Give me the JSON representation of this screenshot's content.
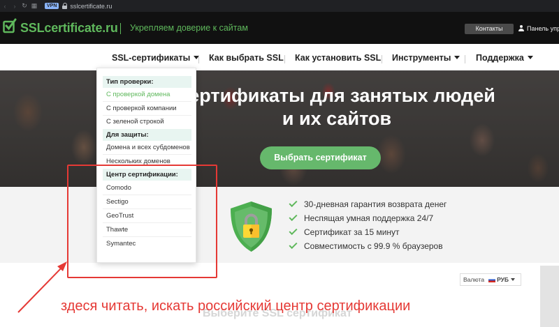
{
  "browser": {
    "vpn_badge": "VPN",
    "url": "sslcertificate.ru"
  },
  "header": {
    "logo": "SSLcertificate.ru",
    "tagline": "Укрепляем доверие к сайтам",
    "contacts_button": "Контакты",
    "panel_link": "Панель управления",
    "brand_color": "#5fb85c"
  },
  "nav": {
    "items": [
      {
        "label": "SSL-сертификаты",
        "has_caret": true
      },
      {
        "label": "Как выбрать SSL",
        "has_caret": false
      },
      {
        "label": "Как установить SSL",
        "has_caret": false
      },
      {
        "label": "Инструменты",
        "has_caret": true
      },
      {
        "label": "Поддержка",
        "has_caret": true
      }
    ]
  },
  "hero": {
    "title": "сертификаты для занятых людей и их сайтов",
    "button": "Выбрать сертификат",
    "button_color": "#66b86c"
  },
  "dropdown": {
    "sections": [
      {
        "heading": "Тип проверки:",
        "items": [
          "С проверкой домена",
          "С проверкой компании",
          "С зеленой строкой"
        ]
      },
      {
        "heading": "Для защиты:",
        "items": [
          "Домена и всех субдоменов",
          "Нескольких доменов"
        ]
      },
      {
        "heading": "Центр сертификации:",
        "items": [
          "Comodo",
          "Sectigo",
          "GeoTrust",
          "Thawte",
          "Symantec"
        ]
      }
    ],
    "active_item": "С проверкой домена",
    "heading_bg": "#e8f5f1"
  },
  "features": [
    "30-дневная гарантия возврата денег",
    "Неспящая умная поддержка 24/7",
    "Сертификат за 15 минут",
    "Совместимость с 99.9 % браузеров"
  ],
  "currency": {
    "label": "Валюта",
    "selected": "РУБ"
  },
  "bottom": {
    "ghost_text": "Выберите SSL сертификат"
  },
  "annotation": {
    "note": "здеся читать, искать российский центр сертификации",
    "color": "#e53935"
  },
  "icons": [
    "back-arrow-icon",
    "forward-arrow-icon",
    "reload-icon",
    "apps-grid-icon",
    "lock-icon",
    "logo-check-icon",
    "user-icon",
    "caret-down-icon",
    "shield-lock-icon",
    "check-icon",
    "flag-ru-icon"
  ]
}
